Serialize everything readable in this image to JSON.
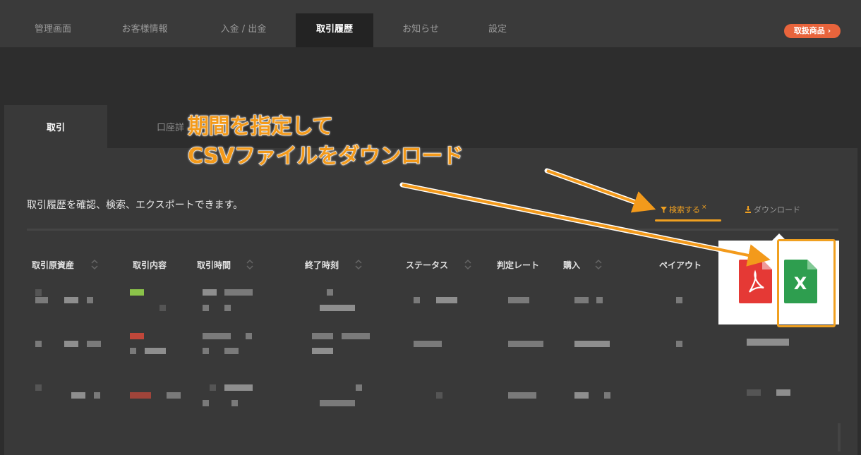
{
  "nav": {
    "items": [
      "管理画面",
      "お客様情報",
      "入金 / 出金",
      "取引履歴",
      "お知らせ",
      "設定"
    ],
    "active": "取引履歴",
    "products_button": "取扱商品 ›"
  },
  "subtabs": {
    "trade": "取引",
    "account": "口座詳"
  },
  "description": "取引履歴を確認、検索、エクスポートできます。",
  "actions": {
    "search": "検索する",
    "search_close": "×",
    "download": "ダウンロード"
  },
  "table": {
    "headers": [
      "取引原資産",
      "取引内容",
      "取引時間",
      "終了時刻",
      "ステータス",
      "判定レート",
      "購入",
      "ペイアウト"
    ],
    "sortable": [
      true,
      false,
      true,
      true,
      true,
      false,
      true,
      false
    ],
    "row_color_marks": [
      "#8bc34a",
      "#c0473a",
      "#a0443a"
    ]
  },
  "callout": {
    "line1": "期間を指定して",
    "line2": "CSVファイルをダウンロード",
    "color": "#f39a1b"
  },
  "download_popup": {
    "pdf_icon_color": "#e53935",
    "excel_icon_color": "#2e9e4f",
    "excel_letter": "X"
  },
  "colors": {
    "accent": "#f0a020",
    "brand_button": "#e8643c"
  }
}
